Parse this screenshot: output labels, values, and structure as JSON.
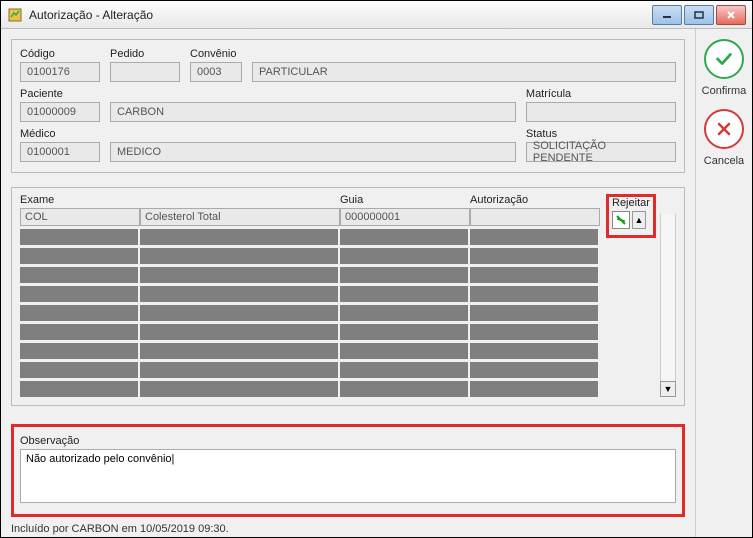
{
  "window": {
    "title": "Autorização - Alteração"
  },
  "labels": {
    "codigo": "Código",
    "pedido": "Pedido",
    "convenio": "Convênio",
    "paciente": "Paciente",
    "matricula": "Matrícula",
    "medico": "Médico",
    "status": "Status",
    "exame": "Exame",
    "guia": "Guia",
    "autorizacao": "Autorização",
    "rejeitar": "Rejeitar",
    "observacao": "Observação"
  },
  "fields": {
    "codigo": "0100176",
    "pedido": "",
    "convenio_code": "0003",
    "convenio_name": "PARTICULAR",
    "paciente_code": "01000009",
    "paciente_name": "CARBON",
    "matricula": "",
    "medico_code": "0100001",
    "medico_name": "MEDICO",
    "status": "SOLICITAÇÃO PENDENTE"
  },
  "grid": {
    "row": {
      "exame_code": "COL",
      "exame_name": "Colesterol Total",
      "guia": "000000001",
      "autorizacao": ""
    }
  },
  "observacao": "Não autorizado pelo convênio|",
  "footer": "Incluído por CARBON em 10/05/2019 09:30.",
  "side": {
    "confirma": "Confirma",
    "cancela": "Cancela"
  }
}
